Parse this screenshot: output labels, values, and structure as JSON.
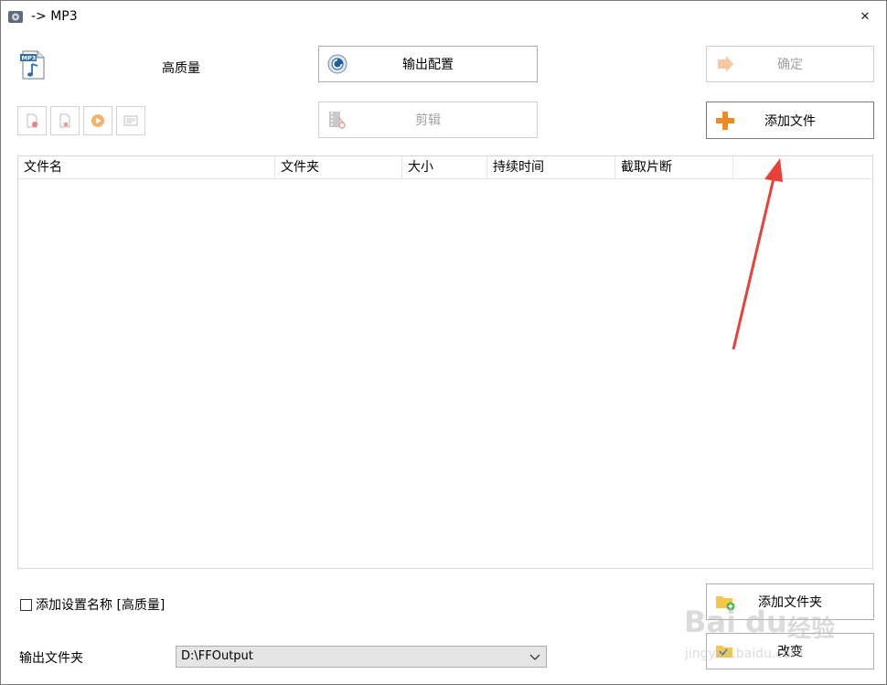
{
  "window": {
    "title": "-> MP3",
    "close_glyph": "✕"
  },
  "profile": {
    "icon": "mp3-file-icon",
    "quality": "高质量"
  },
  "buttons": {
    "output_config": "输出配置",
    "confirm": "确定",
    "edit": "剪辑",
    "add_file": "添加文件",
    "add_folder": "添加文件夹",
    "change": "改变"
  },
  "toolbar": [
    "remove-file-icon",
    "clear-list-icon",
    "play-icon",
    "media-info-icon"
  ],
  "file_list": {
    "columns": [
      "文件名",
      "文件夹",
      "大小",
      "持续时间",
      "截取片断"
    ]
  },
  "options": {
    "add_setting_name": "添加设置名称 [高质量]"
  },
  "output": {
    "label": "输出文件夹",
    "folder": "D:\\FFOutput"
  },
  "watermark": {
    "brand": "Bai",
    "brand2": "du",
    "cn": "经验",
    "url": "jingyan.baidu.com"
  },
  "colors": {
    "arrow": "#e8413a",
    "accent_orange": "#f08a24"
  }
}
